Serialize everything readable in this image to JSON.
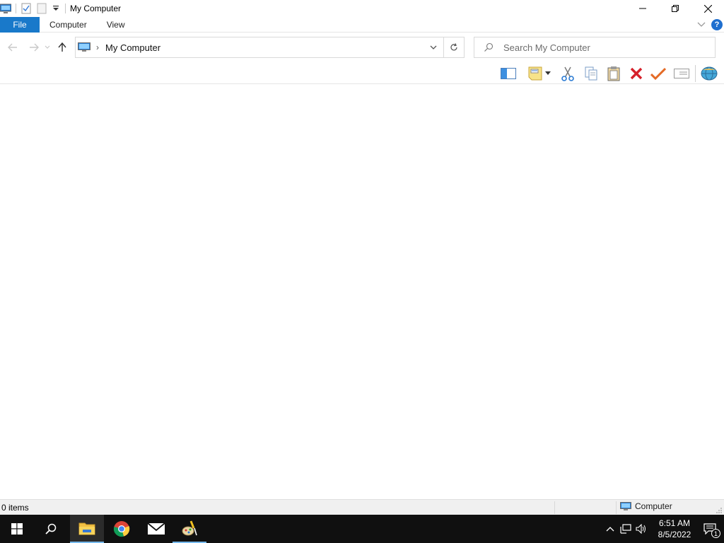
{
  "window": {
    "title": "My Computer",
    "controls": [
      "minimize",
      "restore",
      "close"
    ]
  },
  "qat": {
    "icons": [
      "computer-icon",
      "properties-icon",
      "new-folder-icon",
      "customize-dropdown-icon"
    ]
  },
  "ribbon": {
    "file_tab": "File",
    "tabs": [
      {
        "label": "Computer"
      },
      {
        "label": "View"
      }
    ]
  },
  "nav": {
    "back": "Back",
    "forward": "Forward",
    "up": "Up"
  },
  "address": {
    "path": "My Computer",
    "separator": "›"
  },
  "search": {
    "placeholder": "Search My Computer"
  },
  "toolbar": {
    "icons": [
      "preview-pane-icon",
      "properties-note-icon",
      "cut-icon",
      "copy-icon",
      "paste-icon",
      "delete-icon",
      "checkmark-icon",
      "rename-icon",
      "shell-globe-icon"
    ]
  },
  "status": {
    "items": "0 items",
    "zone": "Computer"
  },
  "taskbar": {
    "apps": [
      "start-icon",
      "search-icon",
      "file-explorer-icon",
      "chrome-icon",
      "mail-icon",
      "paint-app-icon"
    ],
    "time": "6:51 AM",
    "date": "8/5/2022",
    "notification_count": "1"
  },
  "colors": {
    "accent": "#1979ca",
    "taskbar": "#101010",
    "taskbar_highlight": "#76b9ed"
  }
}
